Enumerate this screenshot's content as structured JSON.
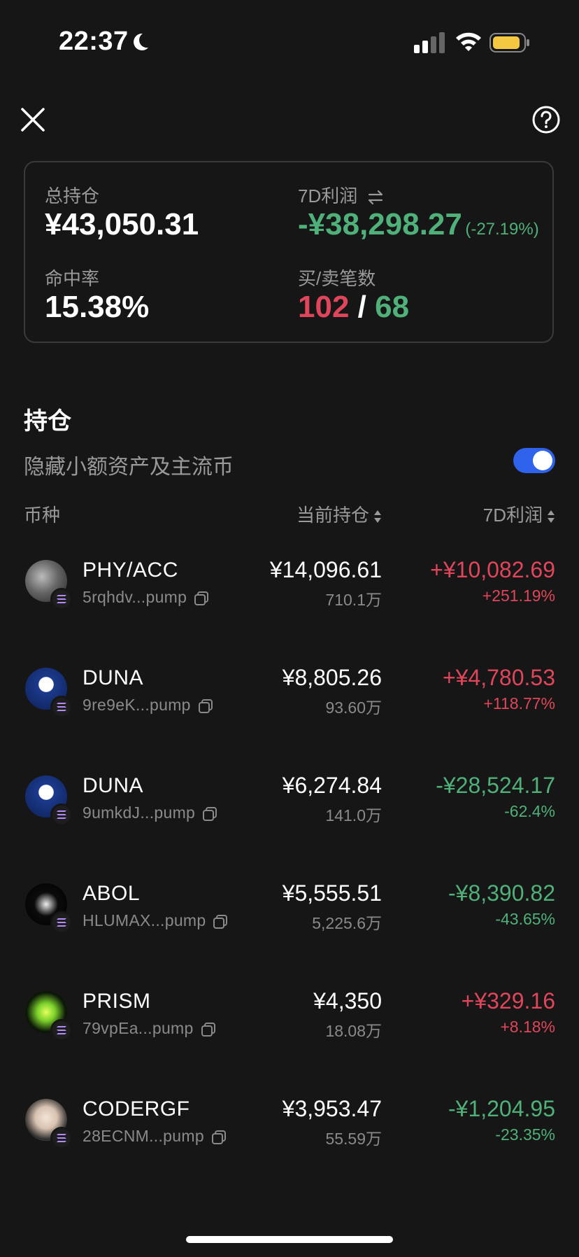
{
  "status_bar": {
    "time": "22:37"
  },
  "summary": {
    "total_label": "总持仓",
    "total_value": "¥43,050.31",
    "profit_label": "7D利润",
    "profit_value": "-¥38,298.27",
    "profit_pct": "(-27.19%)",
    "hit_rate_label": "命中率",
    "hit_rate_value": "15.38%",
    "trades_label": "买/卖笔数",
    "buy_count": "102",
    "separator": "/",
    "sell_count": "68"
  },
  "holdings": {
    "title": "持仓",
    "hide_label": "隐藏小额资产及主流币",
    "hide_toggle_on": true,
    "columns": {
      "coin": "币种",
      "position": "当前持仓",
      "profit": "7D利润"
    },
    "rows": [
      {
        "symbol": "PHY/ACC",
        "address": "5rqhdv...pump",
        "value": "¥14,096.61",
        "quantity": "710.1万",
        "pnl": "+¥10,082.69",
        "pnl_pct": "+251.19%",
        "direction": "up"
      },
      {
        "symbol": "DUNA",
        "address": "9re9eK...pump",
        "value": "¥8,805.26",
        "quantity": "93.60万",
        "pnl": "+¥4,780.53",
        "pnl_pct": "+118.77%",
        "direction": "up"
      },
      {
        "symbol": "DUNA",
        "address": "9umkdJ...pump",
        "value": "¥6,274.84",
        "quantity": "141.0万",
        "pnl": "-¥28,524.17",
        "pnl_pct": "-62.4%",
        "direction": "down"
      },
      {
        "symbol": "ABOL",
        "address": "HLUMAX...pump",
        "value": "¥5,555.51",
        "quantity": "5,225.6万",
        "pnl": "-¥8,390.82",
        "pnl_pct": "-43.65%",
        "direction": "down"
      },
      {
        "symbol": "PRISM",
        "address": "79vpEa...pump",
        "value": "¥4,350",
        "quantity": "18.08万",
        "pnl": "+¥329.16",
        "pnl_pct": "+8.18%",
        "direction": "up"
      },
      {
        "symbol": "CODERGF",
        "address": "28ECNM...pump",
        "value": "¥3,953.47",
        "quantity": "55.59万",
        "pnl": "-¥1,204.95",
        "pnl_pct": "-23.35%",
        "direction": "down"
      }
    ]
  },
  "colors": {
    "up": "#e0465b",
    "down": "#4fb07a",
    "accent": "#2f63ec",
    "battery": "#f5c842"
  }
}
